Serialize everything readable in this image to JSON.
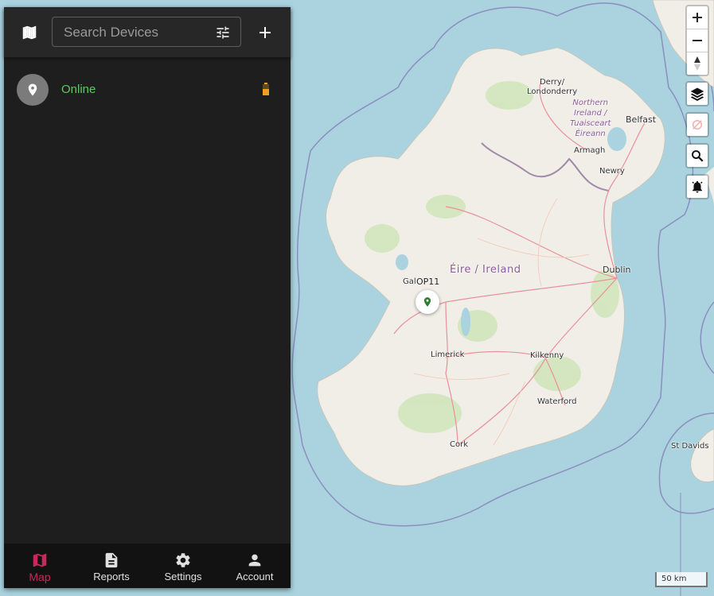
{
  "search": {
    "placeholder": "Search Devices"
  },
  "device": {
    "status": "Online",
    "status_color": "#5fc95f",
    "battery_color": "#f0a020"
  },
  "marker": {
    "label": "OP11",
    "color": "#2e7d32"
  },
  "nav": {
    "items": [
      {
        "label": "Map",
        "icon": "map-icon",
        "active": true
      },
      {
        "label": "Reports",
        "icon": "reports-icon",
        "active": false
      },
      {
        "label": "Settings",
        "icon": "gear-icon",
        "active": false
      },
      {
        "label": "Account",
        "icon": "account-icon",
        "active": false
      }
    ],
    "active_color": "#c8285a"
  },
  "map": {
    "labels": {
      "derry": "Derry/\nLondonderry",
      "ni": "Northern\nIreland /\nTuaisceart\nÉireann",
      "belfast": "Belfast",
      "armagh": "Armagh",
      "newry": "Newry",
      "country": "Éire / Ireland",
      "dublin": "Dublin",
      "galway": "Gal",
      "limerick": "Limerick",
      "kilkenny": "Kilkenny",
      "waterford": "Waterford",
      "cork": "Cork",
      "stdavids": "St Davids"
    },
    "scale": "50 km"
  }
}
